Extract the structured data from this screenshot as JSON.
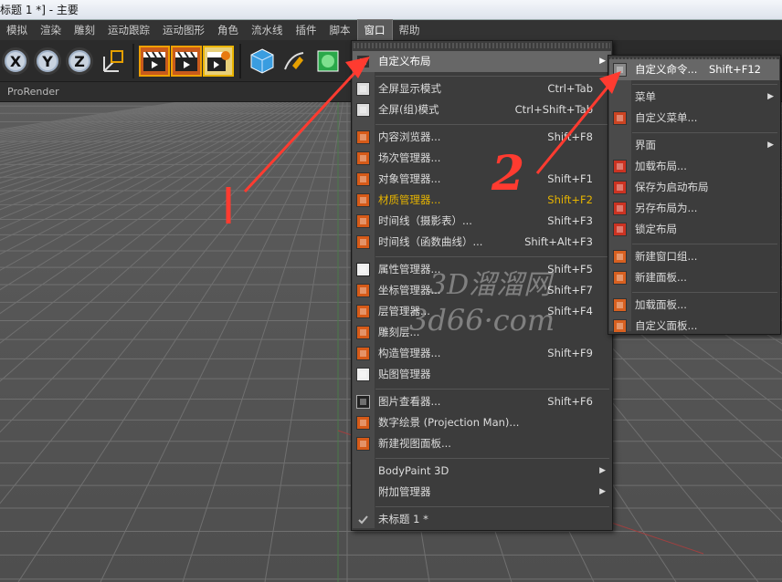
{
  "window_title": "标题 1 *] - 主要",
  "menubar": {
    "items": [
      {
        "label": "模拟",
        "state": ""
      },
      {
        "label": "渲染",
        "state": ""
      },
      {
        "label": "雕刻",
        "state": ""
      },
      {
        "label": "运动跟踪",
        "state": ""
      },
      {
        "label": "运动图形",
        "state": ""
      },
      {
        "label": "角色",
        "state": ""
      },
      {
        "label": "流水线",
        "state": ""
      },
      {
        "label": "插件",
        "state": ""
      },
      {
        "label": "脚本",
        "state": ""
      },
      {
        "label": "窗口",
        "state": "active"
      },
      {
        "label": "帮助",
        "state": ""
      }
    ]
  },
  "toolbar": {
    "axis_x": "X",
    "axis_y": "Y",
    "axis_z": "Z"
  },
  "viewport": {
    "renderer_label": "ProRender"
  },
  "window_menu": {
    "items": [
      {
        "label": "自定义布局",
        "shortcut": "",
        "submenu": true,
        "state": "highlight",
        "icon": "blank"
      },
      {
        "label": "全屏显示模式",
        "shortcut": "Ctrl+Tab",
        "icon": "fullscreen-icon"
      },
      {
        "label": "全屏(组)模式",
        "shortcut": "Ctrl+Shift+Tab",
        "icon": "fullscreen-group-icon"
      },
      {
        "label": "内容浏览器...",
        "shortcut": "Shift+F8",
        "icon": "content-browser-icon"
      },
      {
        "label": "场次管理器...",
        "shortcut": "",
        "icon": "take-manager-icon"
      },
      {
        "label": "对象管理器...",
        "shortcut": "Shift+F1",
        "icon": "object-manager-icon"
      },
      {
        "label": "材质管理器...",
        "shortcut": "Shift+F2",
        "state": "gold",
        "icon": "material-manager-icon"
      },
      {
        "label": "时间线（摄影表）...",
        "shortcut": "Shift+F3",
        "icon": "timeline-icon"
      },
      {
        "label": "时间线（函数曲线）...",
        "shortcut": "Shift+Alt+F3",
        "icon": "fcurve-icon"
      },
      {
        "label": "属性管理器...",
        "shortcut": "Shift+F5",
        "icon": "attribute-manager-icon"
      },
      {
        "label": "坐标管理器...",
        "shortcut": "Shift+F7",
        "icon": "coordinate-manager-icon"
      },
      {
        "label": "层管理器...",
        "shortcut": "Shift+F4",
        "icon": "layer-manager-icon"
      },
      {
        "label": "雕刻层...",
        "shortcut": "",
        "icon": "sculpt-layer-icon"
      },
      {
        "label": "构造管理器...",
        "shortcut": "Shift+F9",
        "icon": "structure-manager-icon"
      },
      {
        "label": "贴图管理器",
        "shortcut": "",
        "icon": "texture-manager-icon"
      },
      {
        "label": "图片查看器...",
        "shortcut": "Shift+F6",
        "icon": "picture-viewer-icon"
      },
      {
        "label": "数字绘景 (Projection Man)...",
        "shortcut": "",
        "icon": "projection-man-icon"
      },
      {
        "label": "新建视图面板...",
        "shortcut": "",
        "icon": "new-view-panel-icon"
      },
      {
        "label": "BodyPaint 3D",
        "shortcut": "",
        "submenu": true,
        "icon": "none"
      },
      {
        "label": "附加管理器",
        "shortcut": "",
        "submenu": true,
        "icon": "none"
      },
      {
        "label": "未标题 1 *",
        "shortcut": "",
        "icon": "check-icon"
      }
    ]
  },
  "custom_layout_menu": {
    "items": [
      {
        "label": "自定义命令...",
        "shortcut": "Shift+F12",
        "state": "highlight",
        "icon": "customize-commands-icon"
      },
      {
        "label": "菜单",
        "submenu": true,
        "icon": "none"
      },
      {
        "label": "自定义菜单...",
        "icon": "customize-menus-icon"
      },
      {
        "label": "界面",
        "submenu": true,
        "icon": "none"
      },
      {
        "label": "加载布局...",
        "icon": "load-layout-icon"
      },
      {
        "label": "保存为启动布局",
        "icon": "save-startup-layout-icon"
      },
      {
        "label": "另存布局为...",
        "icon": "save-layout-as-icon"
      },
      {
        "label": "锁定布局",
        "icon": "lock-layout-icon"
      },
      {
        "label": "新建窗口组...",
        "icon": "new-window-group-icon"
      },
      {
        "label": "新建面板...",
        "icon": "new-panel-icon"
      },
      {
        "label": "加载面板...",
        "icon": "load-panel-icon"
      },
      {
        "label": "自定义面板...",
        "icon": "customize-palettes-icon"
      }
    ]
  },
  "watermark": {
    "line1": "3D溜溜网",
    "line2": "3d66·com"
  },
  "annotations": {
    "label1": "1",
    "label2": "2"
  },
  "colors": {
    "accent": "#e6b400",
    "annotation": "#ff3b30",
    "menu_bg": "#3c3c3c",
    "highlight": "#676767"
  }
}
